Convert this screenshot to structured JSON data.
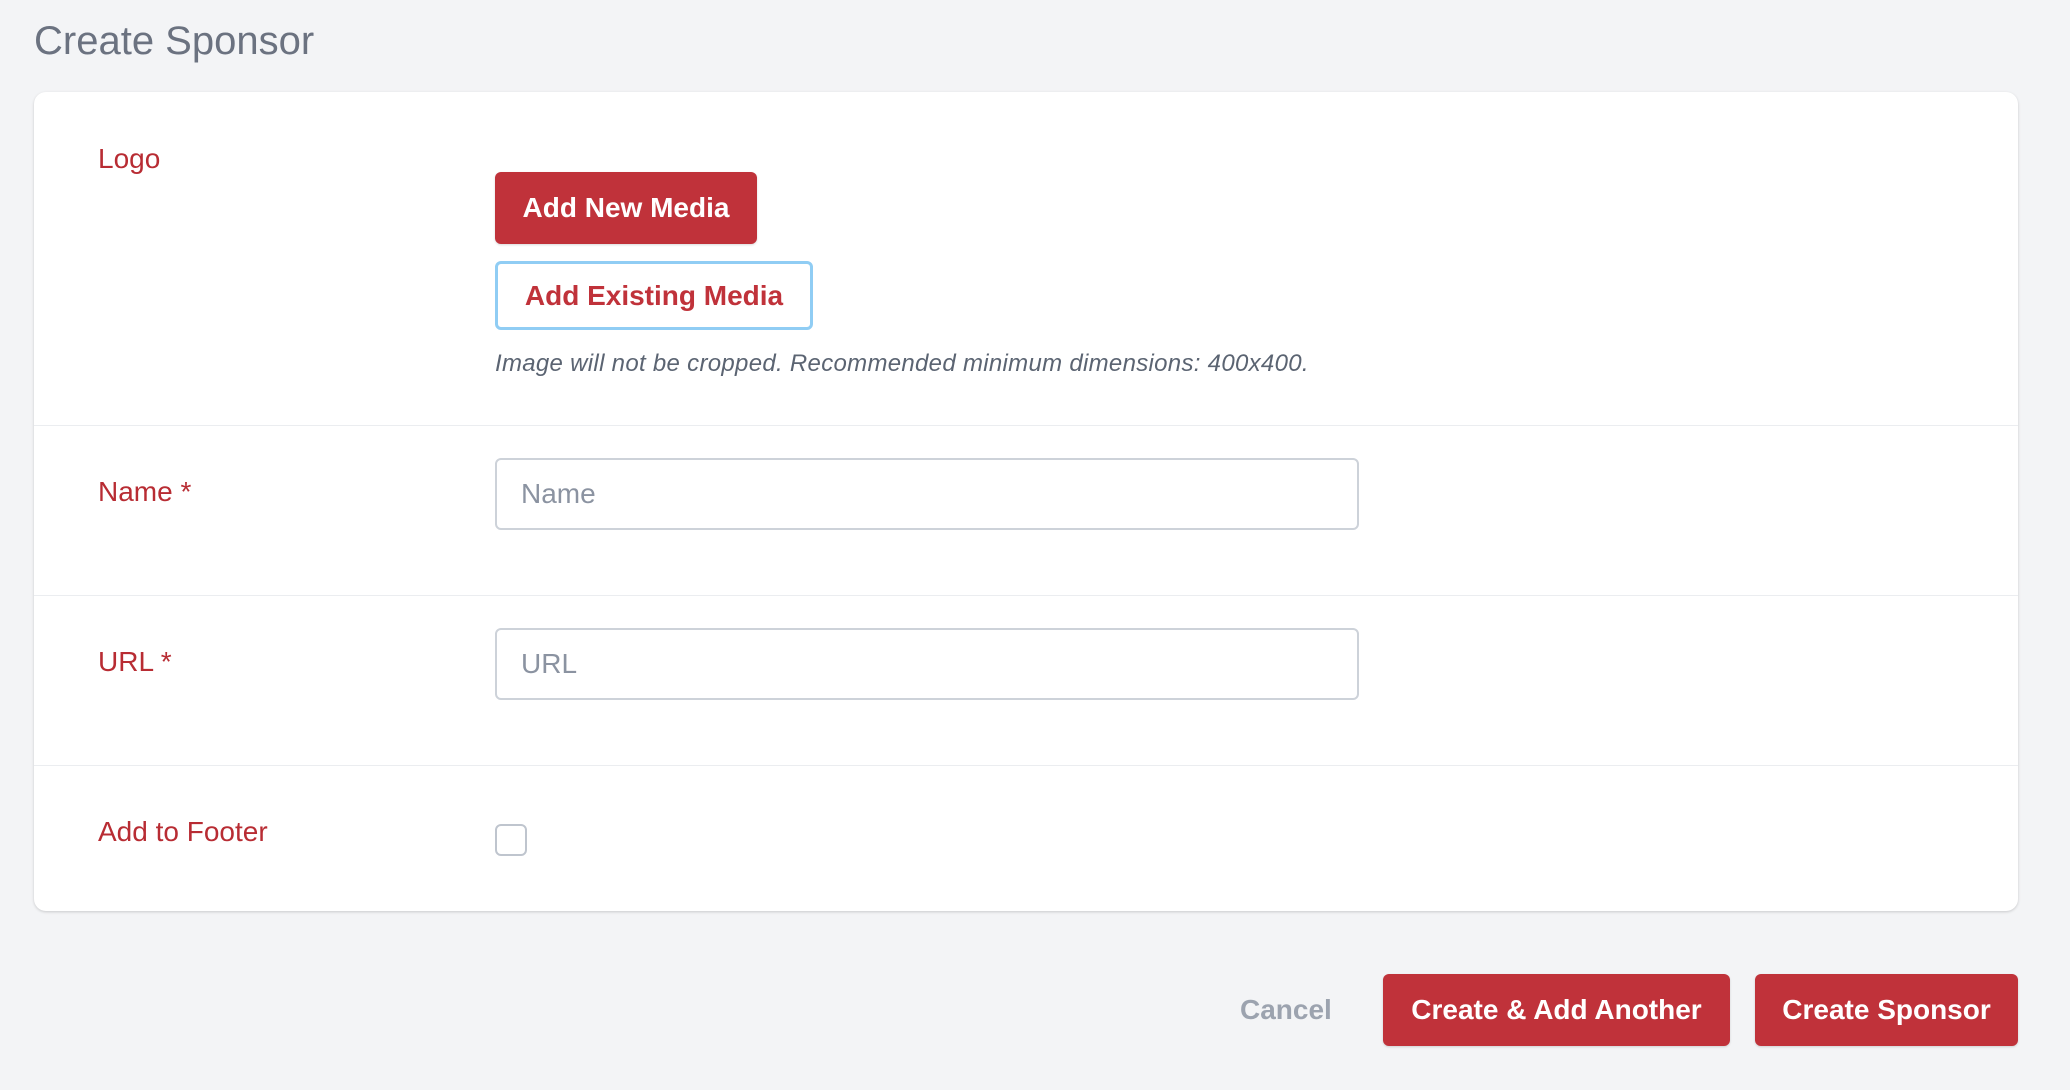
{
  "page": {
    "title": "Create Sponsor"
  },
  "form": {
    "logo": {
      "label": "Logo",
      "add_new_media_label": "Add New Media",
      "add_existing_media_label": "Add Existing Media",
      "hint": "Image will not be cropped. Recommended minimum dimensions: 400x400."
    },
    "name": {
      "label": "Name *",
      "placeholder": "Name",
      "value": ""
    },
    "url": {
      "label": "URL *",
      "placeholder": "URL",
      "value": ""
    },
    "add_to_footer": {
      "label": "Add to Footer",
      "checked": false
    }
  },
  "actions": {
    "cancel_label": "Cancel",
    "create_and_add_another_label": "Create & Add Another",
    "create_label": "Create Sponsor"
  },
  "colors": {
    "accent": "#c0323a",
    "label": "#b82c33",
    "background": "#f3f4f6",
    "focus_border": "#90cdf4"
  }
}
